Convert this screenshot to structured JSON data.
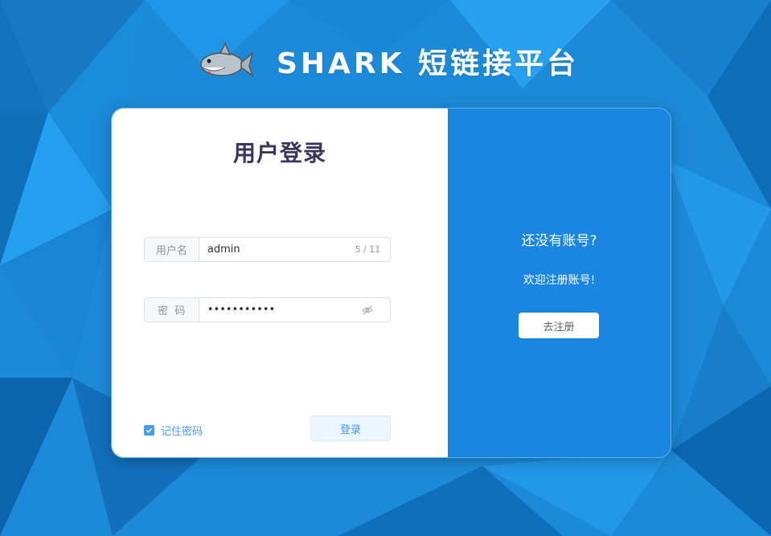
{
  "app": {
    "title": "SHARK 短链接平台"
  },
  "login": {
    "title": "用户登录",
    "username": {
      "label": "用户名",
      "value": "admin",
      "counter": "5 / 11"
    },
    "password": {
      "label": "密  码",
      "value": "•••••••••••"
    },
    "remember_label": "记住密码",
    "remember_checked": true,
    "login_button": "登录"
  },
  "register_panel": {
    "question": "还没有账号?",
    "welcome": "欢迎注册账号!",
    "register_button": "去注册"
  },
  "colors": {
    "primary": "#409eff",
    "panel": "#1a86e1",
    "title": "#38365f"
  }
}
